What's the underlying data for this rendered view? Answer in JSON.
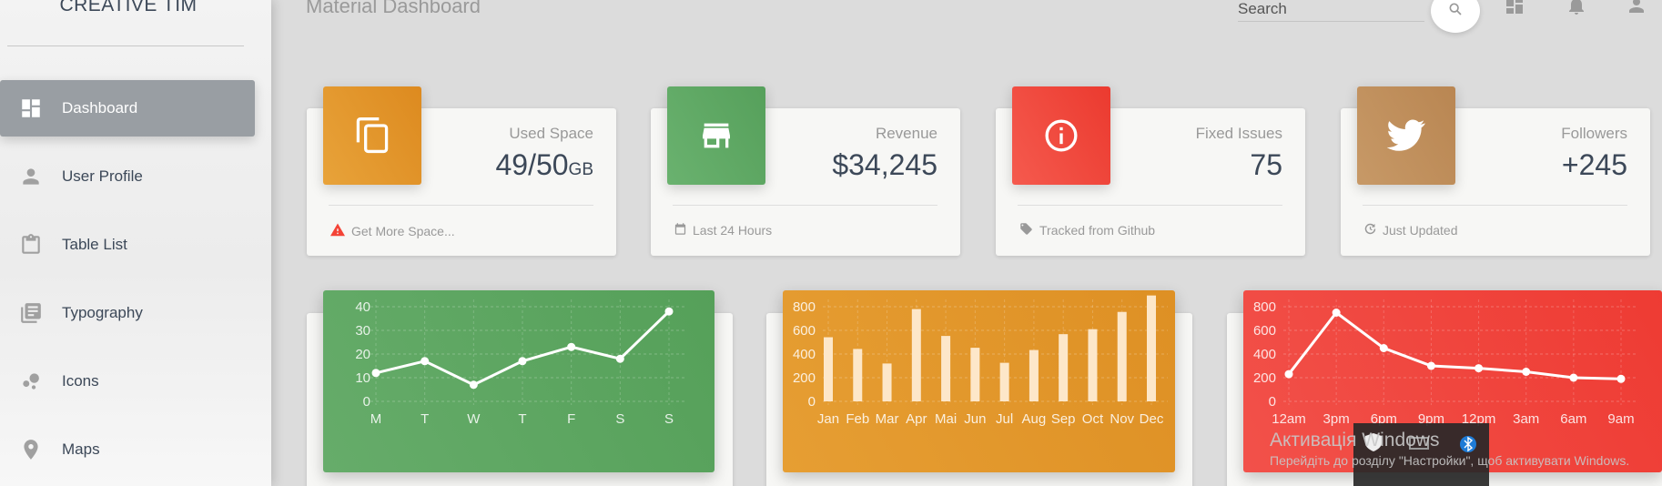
{
  "app": {
    "brand": "CREATIVE TIM",
    "page_title": "Material Dashboard"
  },
  "sidebar": {
    "items": [
      {
        "label": "Dashboard",
        "icon": "dashboard-icon",
        "active": true
      },
      {
        "label": "User Profile",
        "icon": "person-icon",
        "active": false
      },
      {
        "label": "Table List",
        "icon": "clipboard-icon",
        "active": false
      },
      {
        "label": "Typography",
        "icon": "library-books-icon",
        "active": false
      },
      {
        "label": "Icons",
        "icon": "bubble-chart-icon",
        "active": false
      },
      {
        "label": "Maps",
        "icon": "location-pin-icon",
        "active": false
      }
    ]
  },
  "topbar": {
    "search_placeholder": "Search",
    "icons": [
      "search-icon",
      "dashboard-icon",
      "notifications-icon",
      "person-icon"
    ]
  },
  "stats": [
    {
      "category": "Used Space",
      "value": "49/50",
      "unit": "GB",
      "footer": "Get More Space...",
      "footer_icon": "warning-icon",
      "icon": "content-copy-icon",
      "color": "#e0962a"
    },
    {
      "category": "Revenue",
      "value": "$34,245",
      "unit": "",
      "footer": "Last 24 Hours",
      "footer_icon": "calendar-icon",
      "icon": "store-icon",
      "color": "#5fa865"
    },
    {
      "category": "Fixed Issues",
      "value": "75",
      "unit": "",
      "footer": "Tracked from Github",
      "footer_icon": "tag-icon",
      "icon": "info-icon",
      "color": "#f1413c"
    },
    {
      "category": "Followers",
      "value": "+245",
      "unit": "",
      "footer": "Just Updated",
      "footer_icon": "update-icon",
      "icon": "twitter-icon",
      "color": "#c08f5e"
    }
  ],
  "colors": {
    "green": "#5aa55f",
    "orange": "#e2932a",
    "red": "#f0403a"
  },
  "chart_data": [
    {
      "type": "line",
      "categories": [
        "M",
        "T",
        "W",
        "T",
        "F",
        "S",
        "S"
      ],
      "values": [
        12,
        17,
        7,
        17,
        23,
        18,
        38
      ],
      "yticks": [
        0,
        10,
        20,
        30,
        40
      ],
      "ylim": [
        0,
        50
      ],
      "grid": true
    },
    {
      "type": "bar",
      "categories": [
        "Jan",
        "Feb",
        "Mar",
        "Apr",
        "Mai",
        "Jun",
        "Jul",
        "Aug",
        "Sep",
        "Oct",
        "Nov",
        "Dec"
      ],
      "values": [
        542,
        443,
        320,
        780,
        553,
        453,
        326,
        434,
        568,
        610,
        756,
        895
      ],
      "yticks": [
        0,
        200,
        400,
        600,
        800
      ],
      "ylim": [
        0,
        1000
      ],
      "grid": true
    },
    {
      "type": "line",
      "categories": [
        "12am",
        "3pm",
        "6pm",
        "9pm",
        "12pm",
        "3am",
        "6am",
        "9am"
      ],
      "values": [
        230,
        750,
        450,
        300,
        280,
        250,
        200,
        190
      ],
      "yticks": [
        0,
        200,
        400,
        600,
        800
      ],
      "ylim": [
        0,
        1000
      ],
      "grid": true
    }
  ],
  "os_overlay": {
    "activate_title": "Активація Windows",
    "activate_msg": "Перейдіть до розділу \"Настройки\", щоб активувати Windows."
  }
}
